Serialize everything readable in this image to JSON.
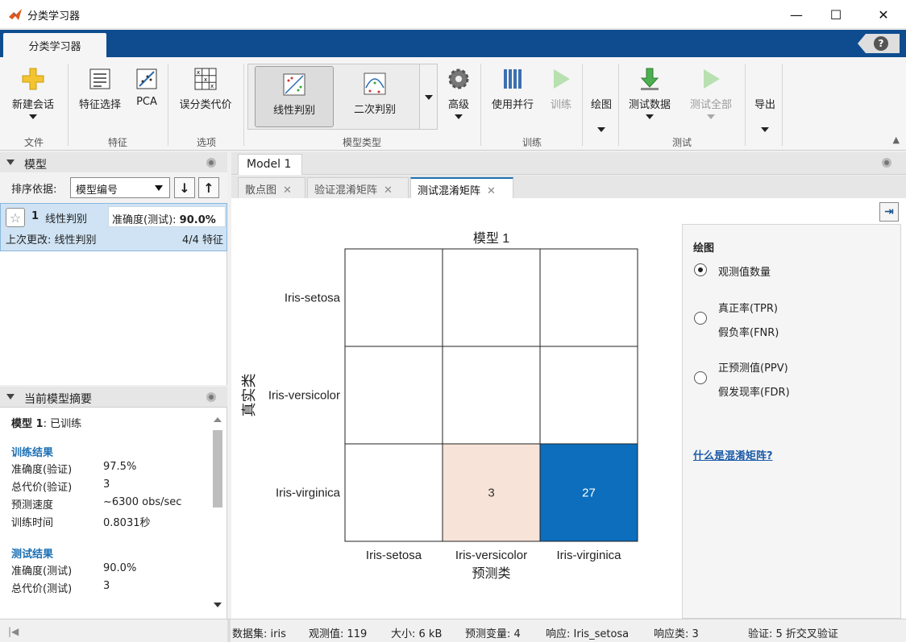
{
  "window": {
    "title": "分类学习器"
  },
  "ribbon_tab": "分类学习器",
  "ribbon": {
    "new_session": "新建会话",
    "feature_selection": "特征选择",
    "pca": "PCA",
    "misclass_cost": "误分类代价",
    "linear_disc": "线性判别",
    "quadratic_disc": "二次判别",
    "advanced": "高级",
    "use_parallel": "使用并行",
    "train": "训练",
    "plot": "绘图",
    "test_data": "测试数据",
    "test_all": "测试全部",
    "export": "导出",
    "sections": {
      "file": "文件",
      "feature": "特征",
      "options": "选项",
      "model_type": "模型类型",
      "training": "训练",
      "test": "测试"
    }
  },
  "models_panel": {
    "title": "模型",
    "sort_label": "排序依据:",
    "sort_value": "模型编号",
    "item": {
      "number": "1",
      "name": "线性判别",
      "accuracy_label": "准确度(测试):",
      "accuracy_value": "90.0%",
      "last_change": "上次更改: 线性判别",
      "features": "4/4 特征"
    }
  },
  "summary_panel": {
    "title": "当前模型摘要",
    "model_label": "模型 1",
    "model_status": ": 已训练",
    "train_header": "训练结果",
    "train_rows": [
      {
        "label": "准确度(验证)",
        "value": "97.5%"
      },
      {
        "label": "总代价(验证)",
        "value": "3"
      },
      {
        "label": "预测速度",
        "value": "~6300 obs/sec"
      },
      {
        "label": "训练时间",
        "value": "0.8031秒"
      }
    ],
    "test_header": "测试结果",
    "test_rows": [
      {
        "label": "准确度(测试)",
        "value": "90.0%"
      },
      {
        "label": "总代价(测试)",
        "value": "3"
      }
    ]
  },
  "doc_tab": "Model 1",
  "sub_tabs": [
    "散点图",
    "验证混淆矩阵",
    "测试混淆矩阵"
  ],
  "chart_data": {
    "type": "heatmap",
    "title": "模型 1",
    "xlabel": "预测类",
    "ylabel": "真实类",
    "x_categories": [
      "Iris-setosa",
      "Iris-versicolor",
      "Iris-virginica"
    ],
    "y_categories": [
      "Iris-setosa",
      "Iris-versicolor",
      "Iris-virginica"
    ],
    "values": [
      [
        null,
        null,
        null
      ],
      [
        null,
        null,
        null
      ],
      [
        null,
        3,
        27
      ]
    ]
  },
  "plot_options": {
    "title": "绘图",
    "opt1": "观测值数量",
    "opt2a": "真正率(TPR)",
    "opt2b": "假负率(FNR)",
    "opt3a": "正预测值(PPV)",
    "opt3b": "假发现率(FDR)",
    "link": "什么是混淆矩阵?"
  },
  "status": {
    "dataset": "数据集: iris",
    "observations": "观测值: 119",
    "size": "大小: 6 kB",
    "predictors": "预测变量: 4",
    "response": "响应: Iris_setosa",
    "response_classes": "响应类: 3",
    "validation": "验证: 5 折交叉验证"
  },
  "colors": {
    "accent": "#0e4c8f",
    "high": "#0c6ebd",
    "low": "#f7e3d8"
  }
}
